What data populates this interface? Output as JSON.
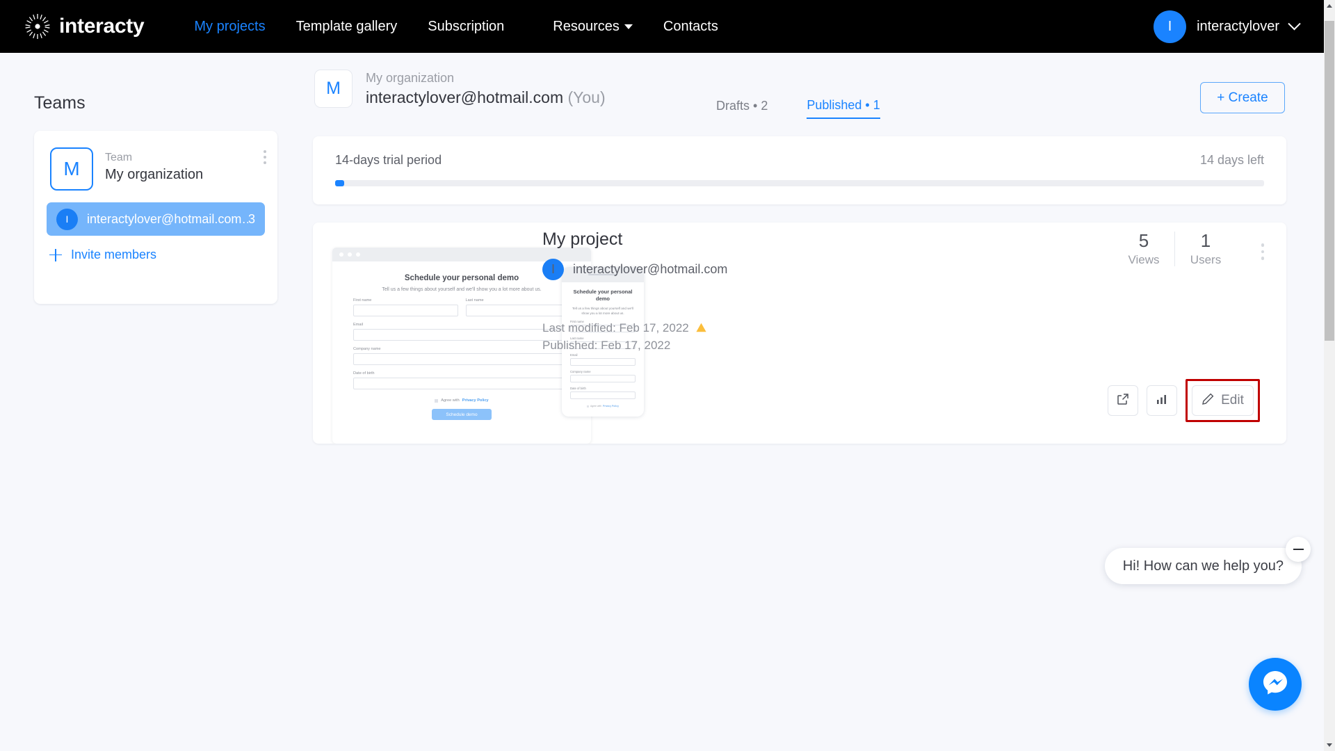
{
  "topnav": {
    "brand": "interacty",
    "brand_icon": "sunburst-logo-icon",
    "items": [
      {
        "label": "My projects",
        "active": true
      },
      {
        "label": "Template gallery",
        "active": false
      },
      {
        "label": "Subscription",
        "active": false
      },
      {
        "label": "Resources",
        "active": false,
        "has_caret": true
      },
      {
        "label": "Contacts",
        "active": false
      }
    ],
    "user": {
      "initial": "I",
      "name": "interactylover",
      "chevron_icon": "chevron-down-icon"
    },
    "colors": {
      "background": "#000000",
      "active_link": "#1a83ff",
      "link": "#ffffff"
    }
  },
  "sidebar": {
    "title": "Teams",
    "team": {
      "initial": "M",
      "label": "Team",
      "name": "My organization",
      "menu_icon": "kebab-menu-icon"
    },
    "member": {
      "initial": "I",
      "email": "interactylover@hotmail.com…",
      "count": "3"
    },
    "invite": {
      "label": "Invite members",
      "icon": "plus-icon"
    }
  },
  "org_header": {
    "badge_initial": "M",
    "org_name": "My organization",
    "email": "interactylover@hotmail.com",
    "you_suffix": "(You)",
    "tabs": [
      {
        "label": "Drafts",
        "count": "2",
        "active": false
      },
      {
        "label": "Published",
        "count": "1",
        "active": true
      }
    ],
    "create_button": "+ Create"
  },
  "trial": {
    "label": "14-days trial period",
    "remaining": "14 days left",
    "progress_percent": 1,
    "accent": "#1a83ff"
  },
  "project": {
    "title": "My project",
    "owner_initial": "I",
    "owner_email": "interactylover@hotmail.com",
    "last_modified": "Last modified: Feb 17, 2022",
    "warning_icon": "warning-triangle-icon",
    "published": "Published: Feb 17, 2022",
    "stats": [
      {
        "value": "5",
        "label": "Views"
      },
      {
        "value": "1",
        "label": "Users"
      }
    ],
    "menu_icon": "kebab-menu-icon",
    "actions": [
      {
        "name": "open-external-button",
        "icon": "external-link-icon",
        "label": ""
      },
      {
        "name": "statistics-button",
        "icon": "bar-chart-icon",
        "label": ""
      },
      {
        "name": "edit-button",
        "icon": "pencil-icon",
        "label": "Edit",
        "highlighted": true,
        "highlight_color": "#c00000"
      }
    ],
    "thumbnail": {
      "browser": {
        "heading": "Schedule your personal demo",
        "subheading": "Tell us a few things about yourself and we'll show you a lot more about us.",
        "fields": [
          "First name",
          "Last name",
          "Email",
          "Company name",
          "Date of birth"
        ],
        "consent_prefix": "Agree with",
        "consent_link": "Privacy Policy",
        "submit": "Schedule demo"
      },
      "phone": {
        "heading": "Schedule your personal demo",
        "subheading": "Tell us a few things about yourself and we'll show you a lot more about us.",
        "fields": [
          "First name",
          "Last name",
          "Email",
          "Company name",
          "Date of birth"
        ],
        "consent_prefix": "Agree with",
        "consent_link": "Privacy Policy"
      }
    }
  },
  "chat": {
    "message": "Hi! How can we help you?",
    "close_icon": "minimize-icon",
    "launcher_icon": "messenger-icon",
    "launcher_color": "#0a84ff"
  },
  "scrollbar": {
    "up_icon": "scroll-up-arrow-icon",
    "down_icon": "scroll-down-arrow-icon"
  }
}
